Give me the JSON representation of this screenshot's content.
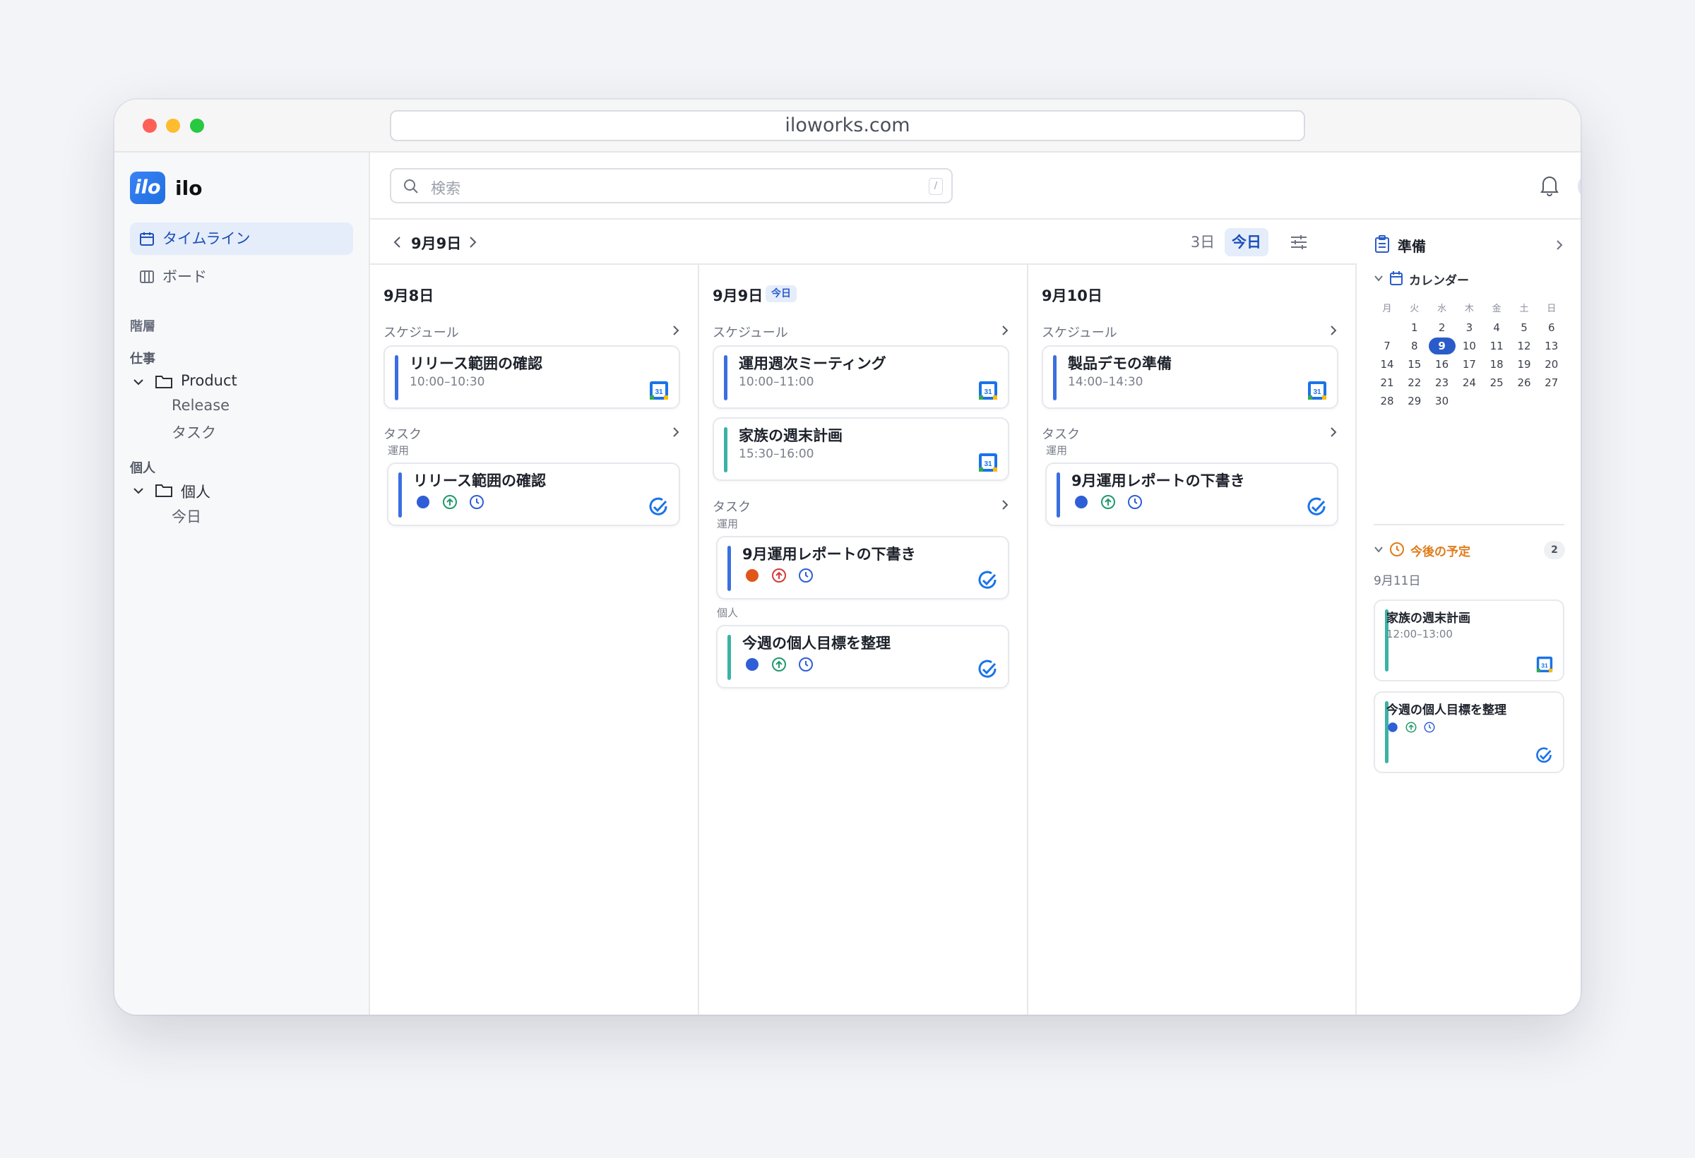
{
  "browser": {
    "url": "iloworks.com"
  },
  "app": {
    "name": "ilo",
    "logo_text": "ilo"
  },
  "sidebar": {
    "nav": [
      {
        "label": "タイムライン",
        "active": true
      },
      {
        "label": "ボード",
        "active": false
      }
    ],
    "hierarchy_label": "階層",
    "groups": [
      {
        "label": "仕事",
        "folder": "Product",
        "children": [
          "Release",
          "タスク"
        ]
      },
      {
        "label": "個人",
        "folder": "個人",
        "children": [
          "今日"
        ]
      }
    ]
  },
  "search": {
    "placeholder": "検索",
    "shortcut": "/"
  },
  "datebar": {
    "current": "9月9日",
    "view_3day": "3日",
    "view_today": "今日"
  },
  "columns": [
    {
      "title": "9月8日",
      "schedule_label": "スケジュール",
      "schedules": [
        {
          "title": "リリース範囲の確認",
          "time": "10:00–10:30",
          "color": "#3b6fe0"
        }
      ],
      "task_label": "タスク",
      "task_groups": [
        {
          "label": "運用",
          "tasks": [
            {
              "title": "リリース範囲の確認",
              "priority_color": "#2f5fd6",
              "color": "#3b6fe0"
            }
          ]
        }
      ]
    },
    {
      "title": "9月9日",
      "badge": "今日",
      "schedule_label": "スケジュール",
      "schedules": [
        {
          "title": "運用週次ミーティング",
          "time": "10:00–11:00",
          "color": "#3b6fe0"
        },
        {
          "title": "家族の週末計画",
          "time": "15:30–16:00",
          "color": "#3cb2a6"
        }
      ],
      "task_label": "タスク",
      "task_groups": [
        {
          "label": "運用",
          "tasks": [
            {
              "title": "9月運用レポートの下書き",
              "priority_color": "#e0561a",
              "color": "#3b6fe0"
            }
          ]
        },
        {
          "label": "個人",
          "tasks": [
            {
              "title": "今週の個人目標を整理",
              "priority_color": "#2f5fd6",
              "color": "#3cb2a6"
            }
          ]
        }
      ]
    },
    {
      "title": "9月10日",
      "schedule_label": "スケジュール",
      "schedules": [
        {
          "title": "製品デモの準備",
          "time": "14:00–14:30",
          "color": "#3b6fe0"
        }
      ],
      "task_label": "タスク",
      "task_groups": [
        {
          "label": "運用",
          "tasks": [
            {
              "title": "9月運用レポートの下書き",
              "priority_color": "#2f5fd6",
              "color": "#3b6fe0"
            }
          ]
        }
      ]
    }
  ],
  "right_panel": {
    "title": "準備",
    "calendar": {
      "label": "カレンダー",
      "weekdays": [
        "月",
        "火",
        "水",
        "木",
        "金",
        "土",
        "日"
      ],
      "weeks": [
        [
          "",
          "1",
          "2",
          "3",
          "4",
          "5",
          "6"
        ],
        [
          "7",
          "8",
          "9",
          "10",
          "11",
          "12",
          "13"
        ],
        [
          "14",
          "15",
          "16",
          "17",
          "18",
          "19",
          "20"
        ],
        [
          "21",
          "22",
          "23",
          "24",
          "25",
          "26",
          "27"
        ],
        [
          "28",
          "29",
          "30",
          "",
          "",
          "",
          ""
        ]
      ],
      "selected": "9"
    },
    "upcoming": {
      "label": "今後の予定",
      "count": "2",
      "date": "9月11日",
      "items": [
        {
          "title": "家族の週末計画",
          "time": "12:00–13:00",
          "kind": "schedule"
        },
        {
          "title": "今週の個人目標を整理",
          "kind": "task"
        }
      ]
    }
  },
  "colors": {
    "accent": "#2a5cc9",
    "teal": "#3cb2a6",
    "orange": "#e07b1a"
  }
}
